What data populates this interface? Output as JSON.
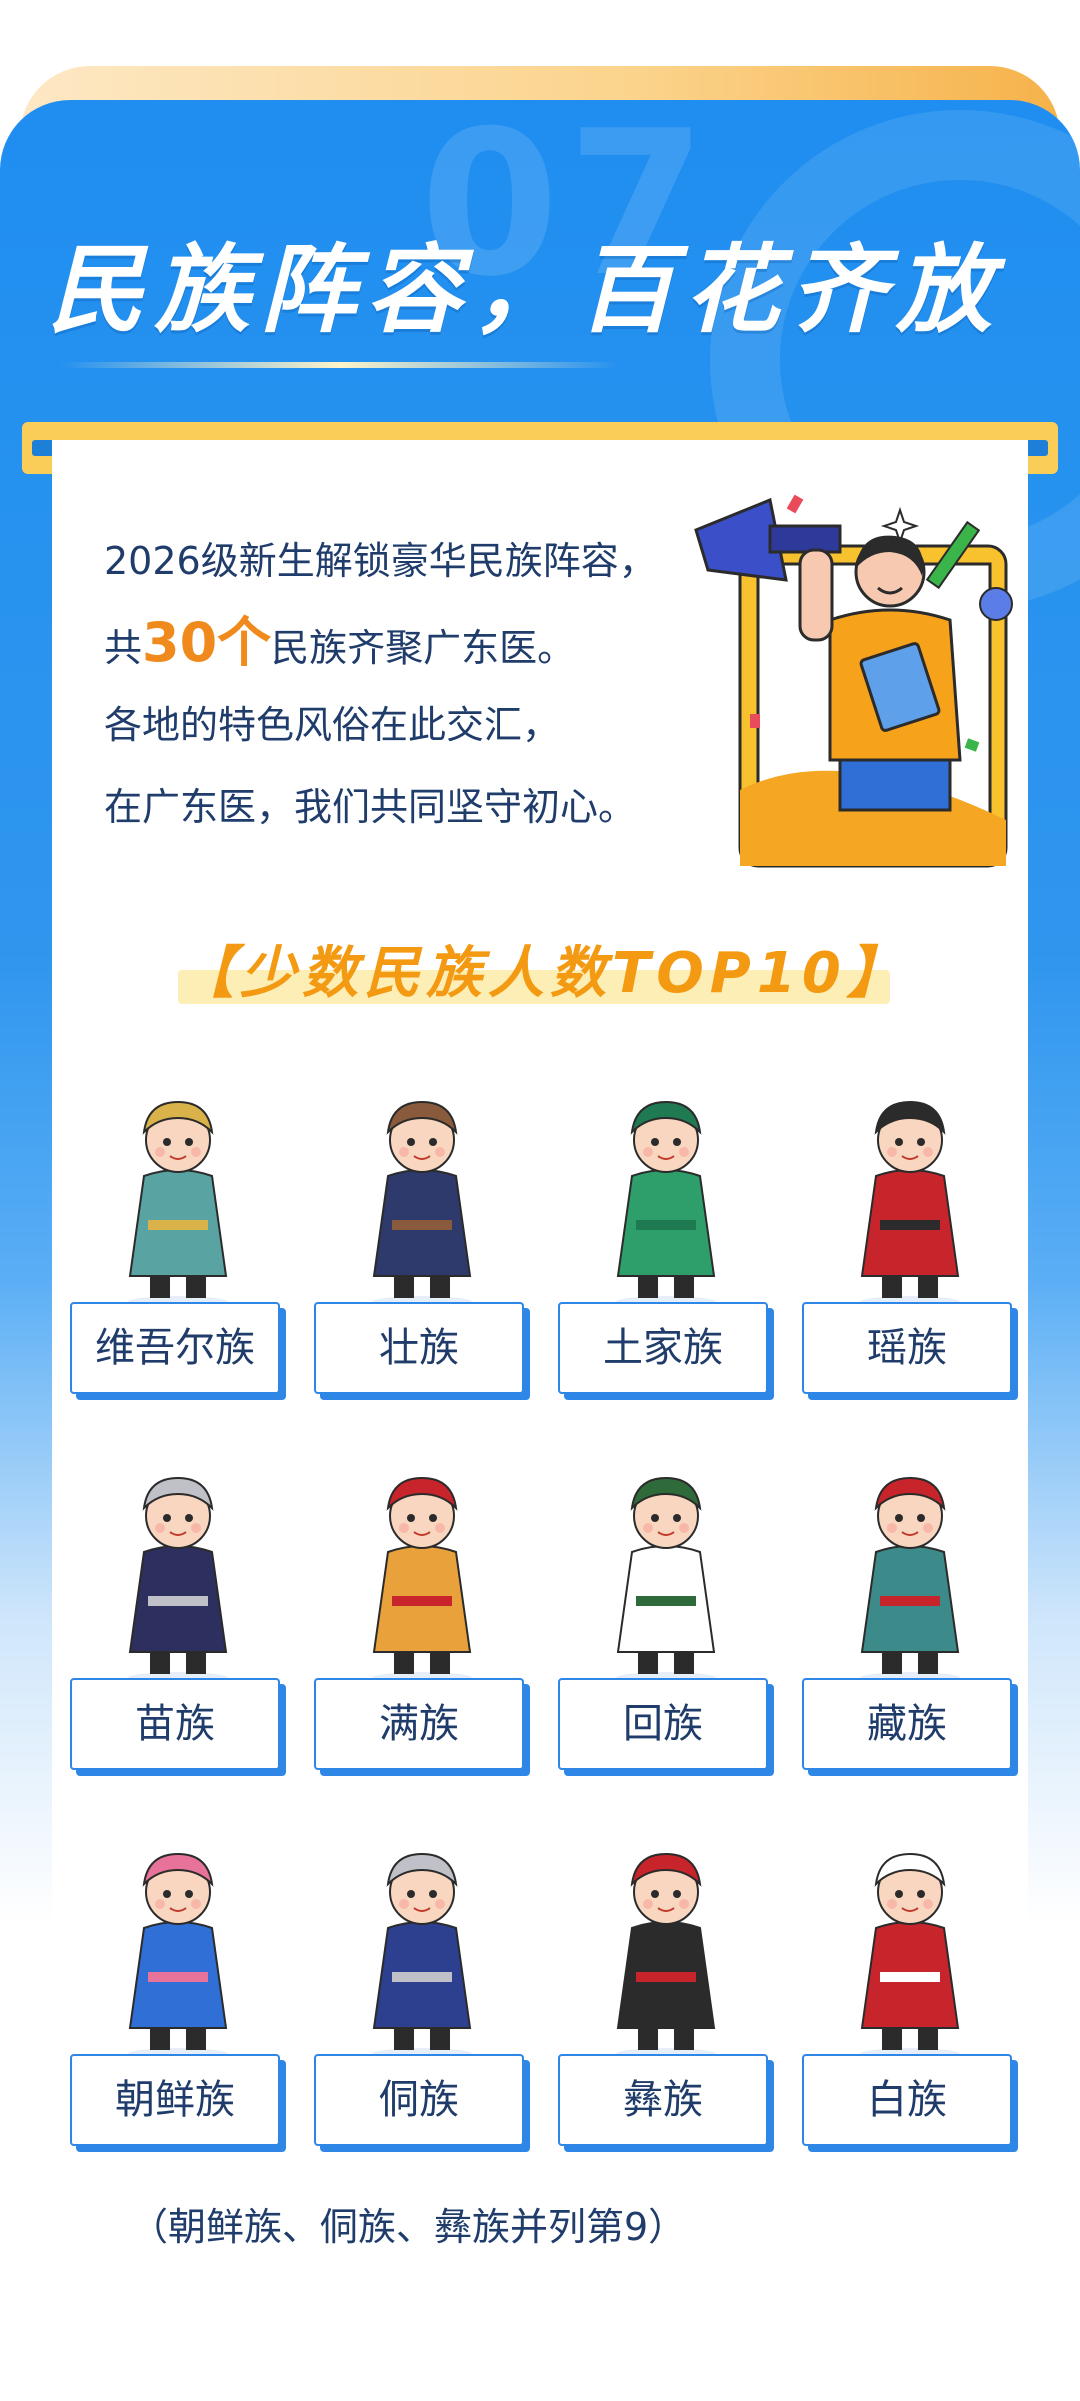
{
  "header": {
    "section_number": "07",
    "title": "民族阵容，百花齐放"
  },
  "intro": {
    "line1": "2026级新生解锁豪华民族阵容，",
    "line2_prefix": "共",
    "line2_highlight": "30个",
    "line2_suffix": "民族齐聚广东医。",
    "line3": "各地的特色风俗在此交汇，",
    "line4": "在广东医，我们共同坚守初心。"
  },
  "ranking": {
    "title": "【少数民族人数TOP10】",
    "groups": [
      {
        "name": "维吾尔族",
        "icon": "uyghur-character-icon"
      },
      {
        "name": "壮族",
        "icon": "zhuang-character-icon"
      },
      {
        "name": "土家族",
        "icon": "tujia-character-icon"
      },
      {
        "name": "瑶族",
        "icon": "yao-character-icon"
      },
      {
        "name": "苗族",
        "icon": "miao-character-icon"
      },
      {
        "name": "满族",
        "icon": "manchu-character-icon"
      },
      {
        "name": "回族",
        "icon": "hui-character-icon"
      },
      {
        "name": "藏族",
        "icon": "tibetan-character-icon"
      },
      {
        "name": "朝鲜族",
        "icon": "korean-character-icon"
      },
      {
        "name": "侗族",
        "icon": "dong-character-icon"
      },
      {
        "name": "彝族",
        "icon": "yi-character-icon"
      },
      {
        "name": "白族",
        "icon": "bai-character-icon"
      }
    ],
    "footnote": "（朝鲜族、侗族、彝族并列第9）"
  },
  "colors": {
    "primary_blue": "#1f8ef0",
    "accent_orange": "#f08a1c",
    "gold": "#f9cd57",
    "text_navy": "#1f3c6b"
  }
}
